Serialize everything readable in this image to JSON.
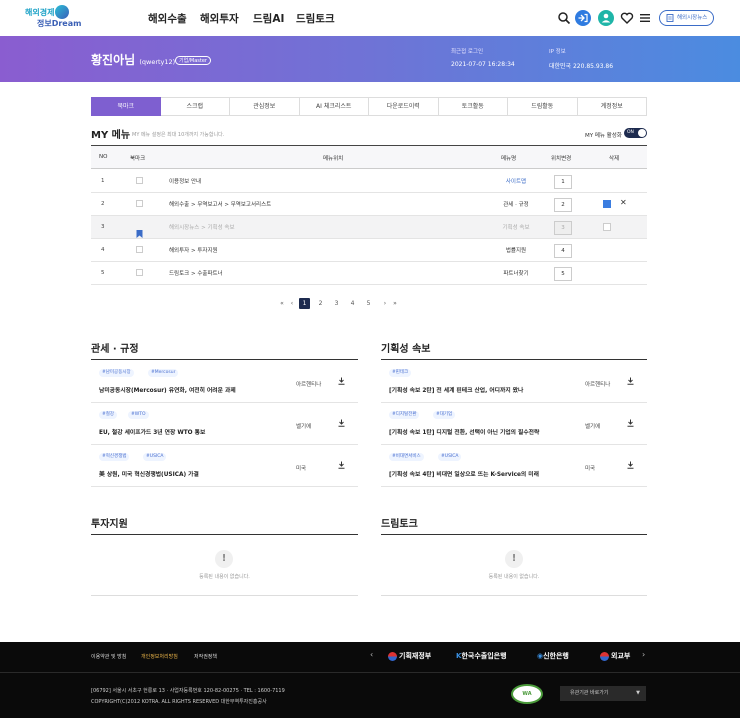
{
  "header": {
    "logo_line1": "해외경제",
    "logo_line2": "정보Dream",
    "nav": [
      "해외수출",
      "해외투자",
      "드림AI",
      "드림토크"
    ],
    "button_label": "해외시장뉴스"
  },
  "banner": {
    "name": "황진아님",
    "user_id": "(qwerty12)",
    "badge": "기업/Master",
    "recent_login_label": "최근접 로그인",
    "recent_login_value": "2021-07-07 16:28:34",
    "ip_label": "IP 정보",
    "ip_value": "대한민국 220.85.93.86"
  },
  "tabs": [
    {
      "label": "북마크",
      "active": true
    },
    {
      "label": "스크랩",
      "active": false
    },
    {
      "label": "관심정보",
      "active": false
    },
    {
      "label": "AI 체크리스트",
      "active": false
    },
    {
      "label": "다운로드이력",
      "active": false
    },
    {
      "label": "토크활동",
      "active": false
    },
    {
      "label": "드림활동",
      "active": false
    },
    {
      "label": "계정정보",
      "active": false
    }
  ],
  "my_menu": {
    "title": "MY 메뉴",
    "subtitle": "MY 메뉴 설정은 최대 10개까지 가능합니다.",
    "toggle_label": "MY 메뉴 활성화",
    "toggle_state": "ON",
    "columns": [
      "NO",
      "북마크",
      "메뉴위치",
      "메뉴명",
      "위치변경",
      "삭제"
    ],
    "rows": [
      {
        "no": "1",
        "path": "이용정보 안내",
        "menu": "사이트맵",
        "order": "1",
        "bookmarked": false,
        "dim": false,
        "link": true,
        "checkbox": false,
        "checked": false,
        "delete": false
      },
      {
        "no": "2",
        "path": "해외수출  >  무역보고서  >  무역보고서리스트",
        "menu": "관세 · 규정",
        "order": "2",
        "bookmarked": false,
        "dim": false,
        "link": false,
        "checkbox": true,
        "checked": true,
        "delete": true
      },
      {
        "no": "3",
        "path": "해외시장뉴스  >  기획성 속보",
        "menu": "기획성 속보",
        "order": "3",
        "bookmarked": true,
        "dim": true,
        "link": false,
        "checkbox": true,
        "checked": false,
        "delete": false
      },
      {
        "no": "4",
        "path": "해외투자  >  투자지원",
        "menu": "법률지원",
        "order": "4",
        "bookmarked": false,
        "dim": false,
        "link": false,
        "checkbox": false,
        "checked": false,
        "delete": false
      },
      {
        "no": "5",
        "path": "드림토크  >  수출파트너",
        "menu": "파트너찾기",
        "order": "5",
        "bookmarked": false,
        "dim": false,
        "link": false,
        "checkbox": false,
        "checked": false,
        "delete": false
      }
    ]
  },
  "pagination": {
    "first": "«",
    "prev": "‹",
    "pages": [
      "1",
      "2",
      "3",
      "4",
      "5"
    ],
    "current": "1",
    "next": "›",
    "last": "»"
  },
  "customs": {
    "title": "관세 · 규정",
    "items": [
      {
        "tags": [
          "#남미공동시장",
          "#Mercosur"
        ],
        "title": "남미공동시장(Mercosur) 유연화, 여전히 어려운 과제",
        "source": "아르헨티나"
      },
      {
        "tags": [
          "#철강",
          "#WTO"
        ],
        "title": "EU, 철강 세이프가드 3년 연장 WTO 통보",
        "source": "벨기에"
      },
      {
        "tags": [
          "#혁신경쟁법",
          "#USICA"
        ],
        "title": "美 상원, 미국 혁신경쟁법(USICA) 가결",
        "source": "미국"
      }
    ]
  },
  "planning": {
    "title": "기획성 속보",
    "items": [
      {
        "tags": [
          "#핀테크"
        ],
        "title": "[기획성 속보 2탄] 전 세계 핀테크 산업, 어디까지 왔나",
        "source": "아르헨티나"
      },
      {
        "tags": [
          "#디지털전환",
          "#대기업"
        ],
        "title": "[기획성 속보 1탄] 디지털 전환, 선택이 아닌 기업의 필수전략",
        "source": "벨기에"
      },
      {
        "tags": [
          "#비대면서비스",
          "#USICA"
        ],
        "title": "[기획성 속보 4탄] 비대면 일상으로 뜨는 K-Service의 미래",
        "source": "미국"
      }
    ]
  },
  "invest": {
    "title": "투자지원",
    "empty": "등록된 내용이 없습니다."
  },
  "dreamtalk": {
    "title": "드림토크",
    "empty": "등록된 내용이 없습니다."
  },
  "footer": {
    "links": [
      "이용약관 및 방침",
      "개인정보처리방침",
      "저작권정책"
    ],
    "partners": [
      "기획재정부",
      "한국수출입은행",
      "신한은행",
      "외교부"
    ],
    "address": "[06792] 서울시 서초구 헌릉로 13    ·  사업자등록번호 120-82-00275    ·  TEL : 1600-7119",
    "copyright": "COPYRIGHT(C)2012 KOTRA. ALL RIGHTS RESERVED 대한무역투자진흥공사",
    "badge": "WA",
    "select_label": "유관기관 바로가기"
  },
  "colors": {
    "accent": "#7e5fd0",
    "link": "#3b6cc7",
    "dark": "#1d2b4f",
    "footer_bg": "#0a0a0a"
  }
}
